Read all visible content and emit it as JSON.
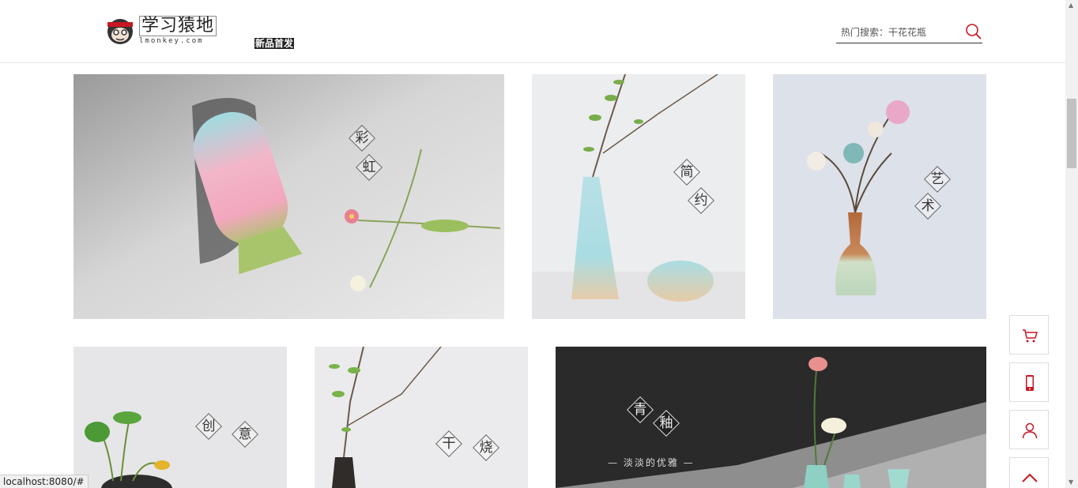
{
  "header": {
    "logo_cn": "学习猿地",
    "logo_en": "lmonkey.com",
    "nav_label": "新品首发",
    "search_placeholder": "热门搜索：干花花瓶"
  },
  "tiles": [
    {
      "id": "rainbow",
      "chars": [
        "彩",
        "虹"
      ]
    },
    {
      "id": "simple",
      "chars": [
        "简",
        "约"
      ]
    },
    {
      "id": "art",
      "chars": [
        "艺",
        "术"
      ]
    },
    {
      "id": "creative",
      "chars": [
        "创",
        "意"
      ]
    },
    {
      "id": "dry-fire",
      "chars": [
        "干",
        "烧"
      ]
    },
    {
      "id": "celadon",
      "chars": [
        "青",
        "釉"
      ],
      "tagline": "— 淡淡的优雅 —"
    }
  ],
  "side_toolbar": [
    "cart-icon",
    "mobile-icon",
    "user-icon",
    "chevron-up-icon"
  ],
  "colors": {
    "accent": "#c81623",
    "text": "#333333"
  },
  "status_bar": "localhost:8080/#"
}
